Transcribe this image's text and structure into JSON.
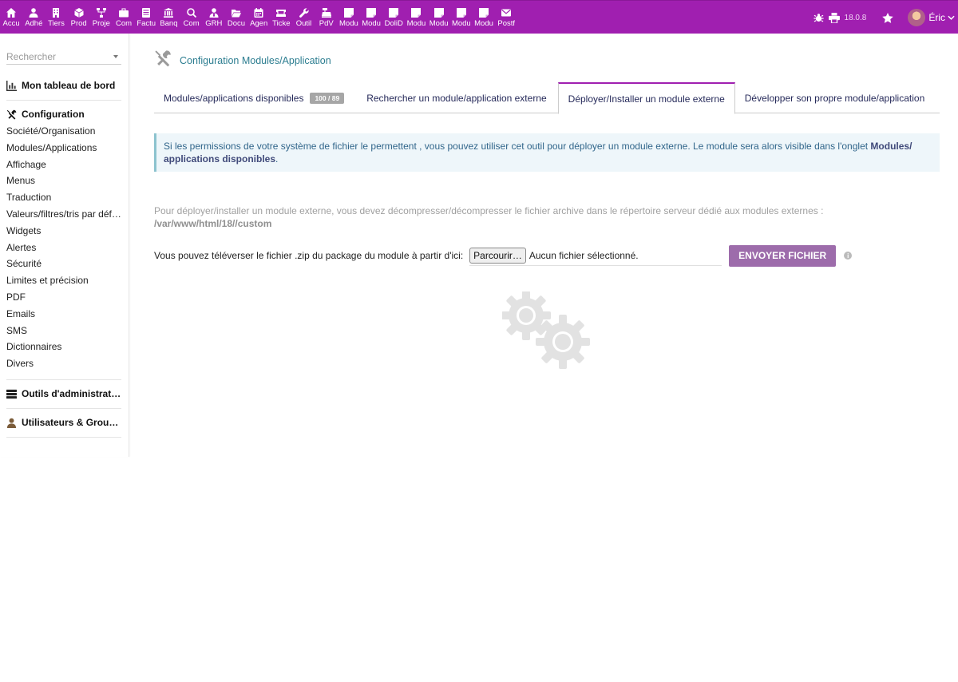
{
  "topmenu": [
    {
      "label": "Accu",
      "icon": "home-icon"
    },
    {
      "label": "Adhé",
      "icon": "member-icon"
    },
    {
      "label": "Tiers",
      "icon": "building-icon"
    },
    {
      "label": "Prod",
      "icon": "cube-icon"
    },
    {
      "label": "Proje",
      "icon": "project-icon"
    },
    {
      "label": "Com",
      "icon": "briefcase-icon"
    },
    {
      "label": "Factu",
      "icon": "invoice-icon"
    },
    {
      "label": "Banq",
      "icon": "bank-icon"
    },
    {
      "label": "Com",
      "icon": "search-dollar-icon"
    },
    {
      "label": "GRH",
      "icon": "user-tie-icon"
    },
    {
      "label": "Docu",
      "icon": "folder-open-icon"
    },
    {
      "label": "Agen",
      "icon": "calendar-icon"
    },
    {
      "label": "Ticke",
      "icon": "ticket-icon"
    },
    {
      "label": "Outil",
      "icon": "wrench-icon"
    },
    {
      "label": "PdV",
      "icon": "cash-register-icon"
    },
    {
      "label": "Modu",
      "icon": "note-icon"
    },
    {
      "label": "Modu",
      "icon": "note-icon"
    },
    {
      "label": "DoliD",
      "icon": "note-icon"
    },
    {
      "label": "Modu",
      "icon": "note-icon"
    },
    {
      "label": "Modu",
      "icon": "note-icon"
    },
    {
      "label": "Modu",
      "icon": "note-icon"
    },
    {
      "label": "Modu",
      "icon": "note-icon"
    },
    {
      "label": "Postf",
      "icon": "envelope-icon"
    }
  ],
  "topright": {
    "version": "18.0.8",
    "user": "Éric"
  },
  "sidebar": {
    "search_placeholder": "Rechercher",
    "dashboard": "Mon tableau de bord",
    "config": {
      "title": "Configuration",
      "items": [
        "Société/Organisation",
        "Modules/Applications",
        "Affichage",
        "Menus",
        "Traduction",
        "Valeurs/filtres/tris par défaut",
        "Widgets",
        "Alertes",
        "Sécurité",
        "Limites et précision",
        "PDF",
        "Emails",
        "SMS",
        "Dictionnaires",
        "Divers"
      ]
    },
    "admin_tools": "Outils d'administration",
    "users_groups": "Utilisateurs & Groupes"
  },
  "page": {
    "title": "Configuration Modules/Application",
    "tabs": {
      "available": "Modules/applications disponibles",
      "available_badge": "100 / 89",
      "search_external": "Rechercher un module/application externe",
      "deploy": "Déployer/Installer un module externe",
      "develop": "Développer son propre module/application"
    },
    "info": {
      "text": "Si les permissions de votre système de fichier le permettent , vous pouvez utiliser cet outil pour déployer un module externe. Le module sera alors visible dans l'onglet ",
      "link1": "Modules/",
      "link2": "applications disponibles",
      "end": "."
    },
    "note": {
      "text": "Pour déployer/installer un module externe, vous devez décompresser/décompresser le fichier archive dans le répertoire serveur dédié aux modules externes :",
      "path": "/var/www/html/18//custom"
    },
    "upload": {
      "label": "Vous pouvez téléverser le fichier .zip du package du module à partir d'ici:",
      "browse": "Parcourir…",
      "no_file": "Aucun fichier sélectionné.",
      "send": "ENVOYER FICHIER"
    }
  },
  "colors": {
    "topbar": "#a01fb0",
    "send_button": "#9d6cab",
    "title": "#2c7d90"
  }
}
